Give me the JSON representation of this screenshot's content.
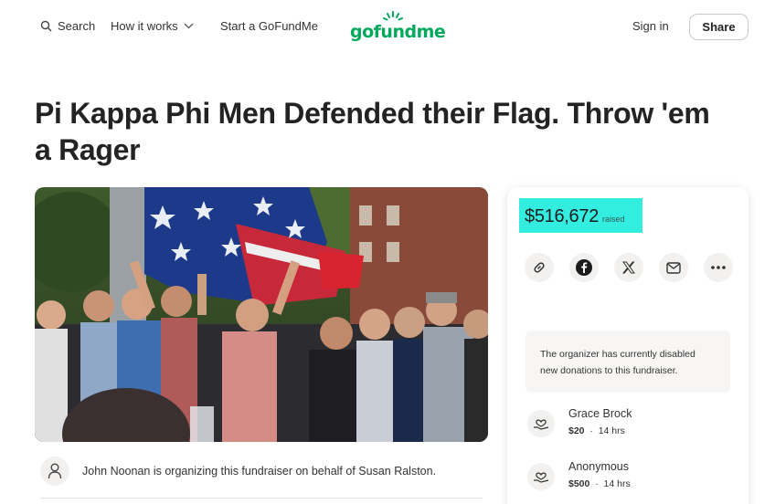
{
  "header": {
    "search_label": "Search",
    "how_label": "How it works",
    "start_label": "Start a GoFundMe",
    "logo_text": "gofundme",
    "signin_label": "Sign in",
    "share_label": "Share"
  },
  "title": "Pi Kappa Phi Men Defended their Flag. Throw 'em a Rager",
  "organizer": {
    "text": "John Noonan is organizing this fundraiser on behalf of Susan Ralston."
  },
  "card": {
    "raised_amount": "$516,672",
    "raised_label": "raised",
    "share_icons": [
      "link-icon",
      "facebook-icon",
      "x-icon",
      "mail-icon",
      "more-icon"
    ],
    "notice": "The organizer has currently disabled new donations to this fundraiser.",
    "donations": [
      {
        "name": "Grace Brock",
        "amount": "$20",
        "time": "14 hrs"
      },
      {
        "name": "Anonymous",
        "amount": "$500",
        "time": "14 hrs"
      }
    ]
  },
  "colors": {
    "brand_green": "#02a95c",
    "raised_highlight": "#33ede0"
  }
}
